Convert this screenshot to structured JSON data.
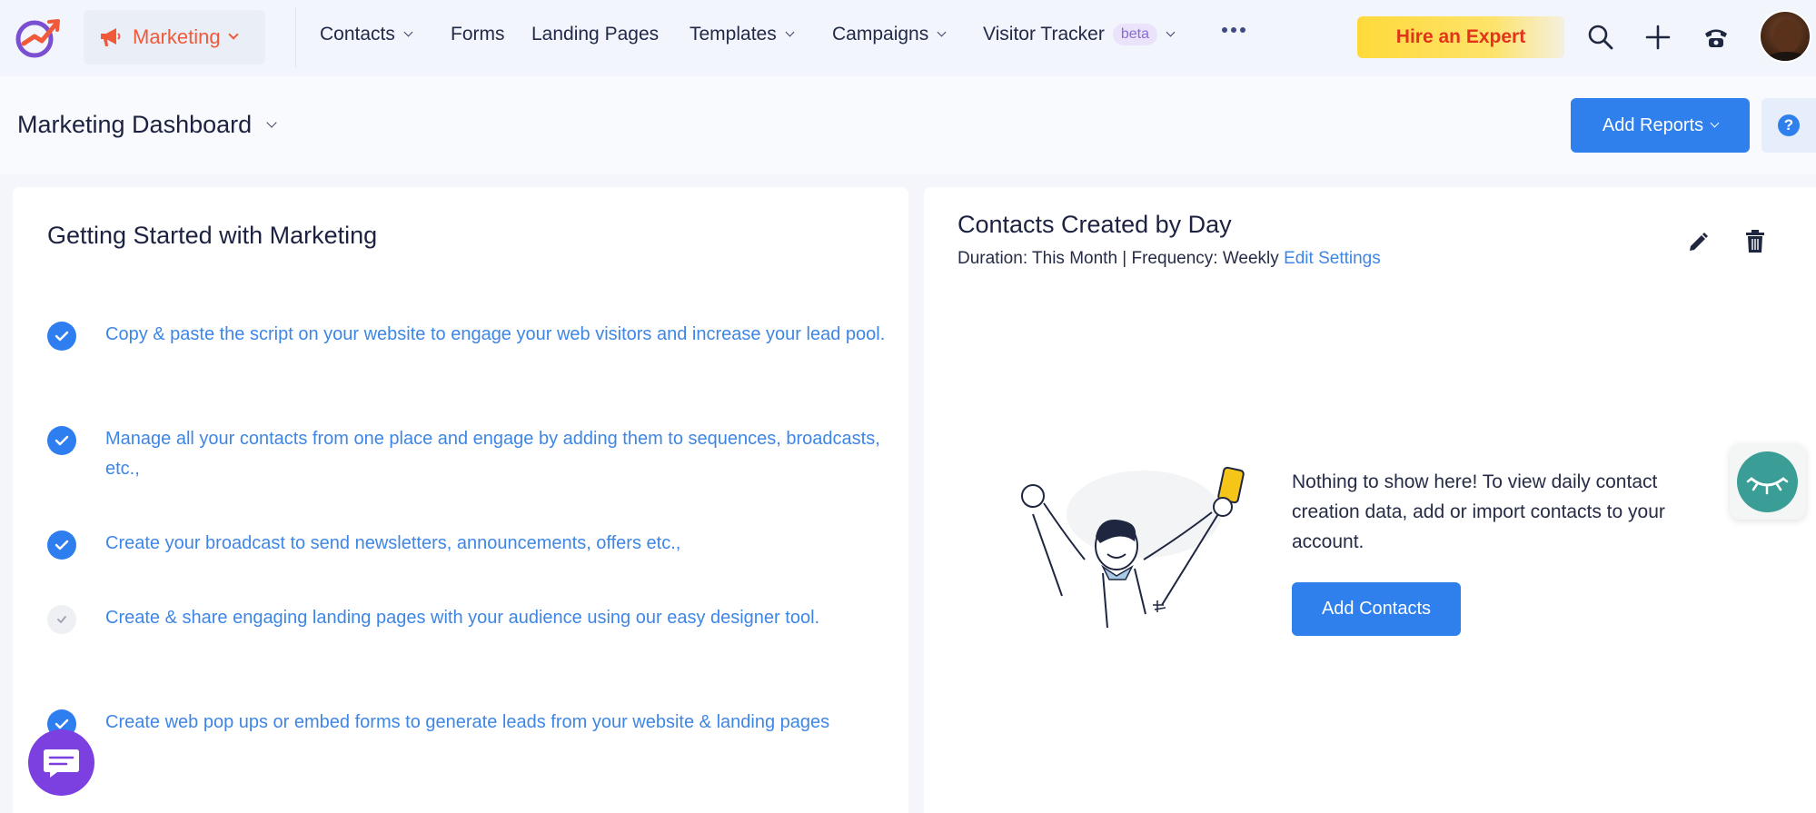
{
  "topnav": {
    "module_label": "Marketing",
    "links": [
      {
        "label": "Contacts",
        "dropdown": true
      },
      {
        "label": "Forms",
        "dropdown": false
      },
      {
        "label": "Landing Pages",
        "dropdown": false
      },
      {
        "label": "Templates",
        "dropdown": true
      },
      {
        "label": "Campaigns",
        "dropdown": true
      },
      {
        "label": "Visitor Tracker",
        "dropdown": true,
        "badge": "beta"
      }
    ],
    "hire_label": "Hire an Expert",
    "icons": [
      "search-icon",
      "plus-icon",
      "phone-icon",
      "avatar"
    ]
  },
  "header": {
    "title": "Marketing Dashboard",
    "add_reports_label": "Add Reports",
    "help_label": "?"
  },
  "getting_started": {
    "title": "Getting Started with Marketing",
    "tasks": [
      {
        "text": "Copy & paste the script on your website to engage your web visitors and increase your lead pool.",
        "done": true
      },
      {
        "text": "Manage all your contacts from one place and engage by adding them to sequences, broadcasts, etc.,",
        "done": true
      },
      {
        "text": "Create your broadcast to send newsletters, announcements, offers etc.,",
        "done": true
      },
      {
        "text": "Create & share engaging landing pages with your audience using our easy designer tool.",
        "done": false
      },
      {
        "text": "Create web pop ups or embed forms to generate leads from your website & landing pages",
        "done": true
      }
    ]
  },
  "contacts_report": {
    "title": "Contacts Created by Day",
    "subtitle": "Duration: This Month | Frequency: Weekly",
    "edit_settings_label": "Edit Settings",
    "empty_message": "Nothing to show here! To view daily contact creation data, add or import contacts to your account.",
    "add_contacts_label": "Add Contacts"
  },
  "colors": {
    "accent": "#2f80ed",
    "brand_orange": "#f05a3a",
    "task_link": "#3e86e6",
    "hire_text": "#e2341a"
  }
}
